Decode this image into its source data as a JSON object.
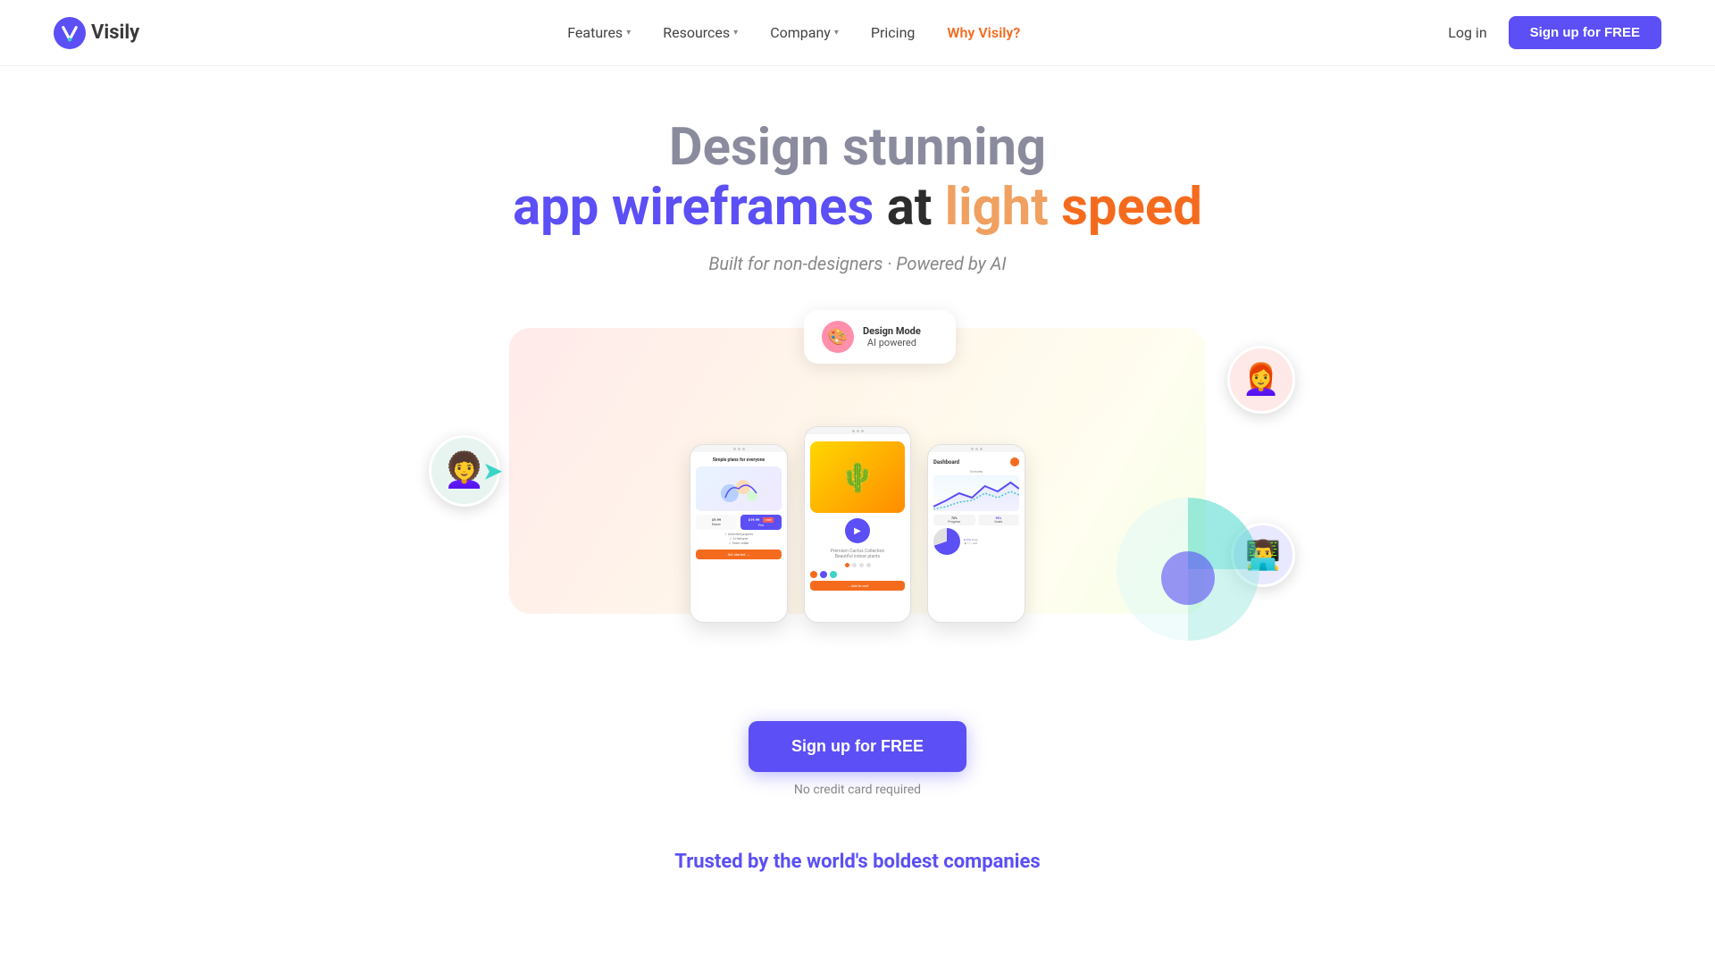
{
  "nav": {
    "logo_text": "Visily",
    "links": [
      {
        "label": "Features",
        "has_arrow": true,
        "active": false
      },
      {
        "label": "Resources",
        "has_arrow": true,
        "active": false
      },
      {
        "label": "Company",
        "has_arrow": true,
        "active": false
      },
      {
        "label": "Pricing",
        "has_arrow": false,
        "active": false
      },
      {
        "label": "Why Visily?",
        "has_arrow": false,
        "active": true
      }
    ],
    "login_label": "Log in",
    "signup_label": "Sign up for FREE"
  },
  "hero": {
    "title_line1": "Design stunning",
    "title_line2_app": "app ",
    "title_line2_wireframes": "wireframes ",
    "title_line2_at": "at ",
    "title_line2_light": "light ",
    "title_line2_speed": "speed",
    "subtitle": "Built for non-designers · Powered by AI"
  },
  "phones": {
    "phone1_title": "Simple plans for everyone",
    "phone2_cta": "→ Add to cart",
    "phone3_title": "Dashboard"
  },
  "cta": {
    "button_label": "Sign up for FREE",
    "note": "No credit card required"
  },
  "trusted": {
    "title": "Trusted by the world's boldest companies"
  }
}
